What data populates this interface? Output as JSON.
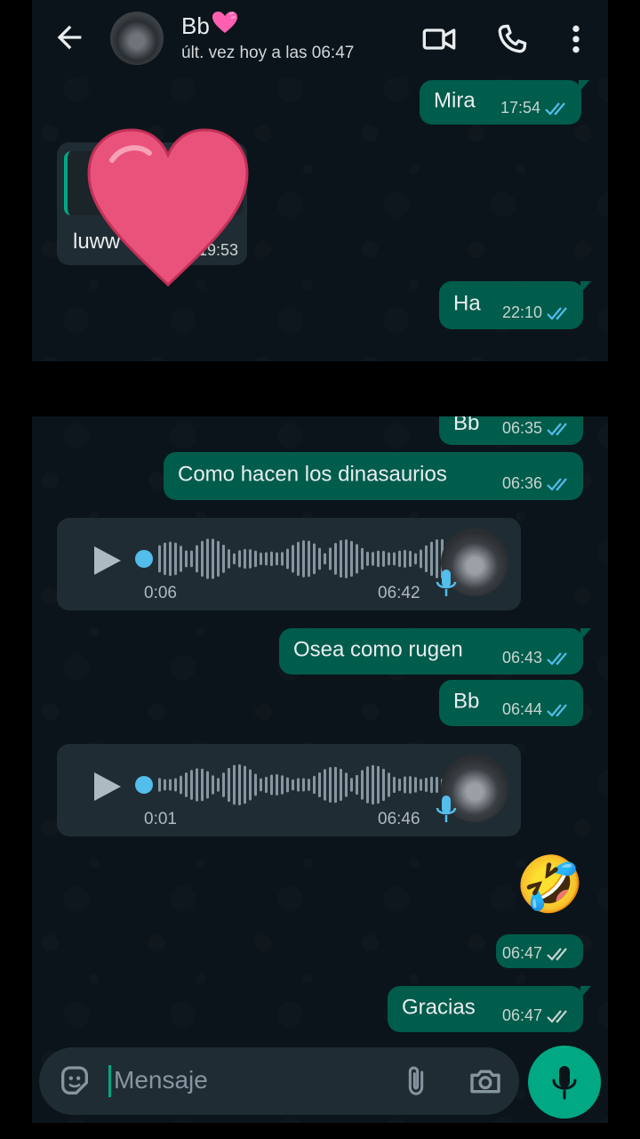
{
  "header": {
    "name": "Bb",
    "status": "últ. vez hoy a las 06:47",
    "icons": [
      "back-arrow-icon",
      "avatar",
      "video-call-icon",
      "phone-call-icon",
      "more-options-icon"
    ]
  },
  "messages": [
    {
      "id": "m1",
      "dir": "out",
      "text": "Mira",
      "time": "17:54"
    },
    {
      "id": "m2",
      "dir": "in",
      "text": "luww",
      "time": "19:53"
    },
    {
      "id": "m3",
      "dir": "out",
      "text": "Ha",
      "time": "22:10"
    },
    {
      "id": "m4",
      "dir": "out",
      "text": "Bb",
      "time": "06:35"
    },
    {
      "id": "m5",
      "dir": "out",
      "text": "Como hacen los dinasaurios",
      "time": "06:36"
    },
    {
      "id": "m6",
      "dir": "in",
      "type": "voice",
      "duration": "0:06",
      "time": "06:42"
    },
    {
      "id": "m7",
      "dir": "out",
      "text": "Osea como rugen",
      "time": "06:43"
    },
    {
      "id": "m8",
      "dir": "out",
      "text": "Bb",
      "time": "06:44"
    },
    {
      "id": "m9",
      "dir": "in",
      "type": "voice",
      "duration": "0:01",
      "time": "06:46"
    },
    {
      "id": "m10",
      "dir": "out",
      "type": "emoji",
      "emoji": "🤣",
      "time": "06:47"
    },
    {
      "id": "m11",
      "dir": "out",
      "text": "Gracias",
      "time": "06:47"
    }
  ],
  "input": {
    "placeholder": "Mensaje"
  },
  "colors": {
    "outgoing": "#005c4b",
    "incoming": "#202c33",
    "accent": "#00a884",
    "read_ticks": "#53bdeb"
  }
}
